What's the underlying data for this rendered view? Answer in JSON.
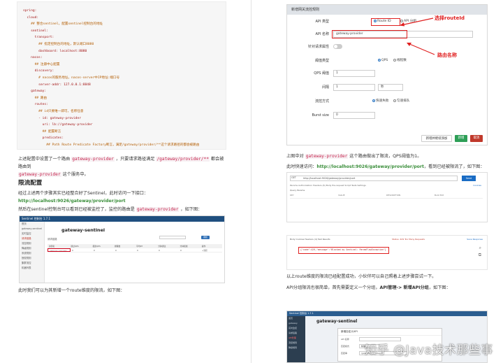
{
  "left_page": {
    "code_lines": [
      {
        "key": "spring:",
        "comment": ""
      },
      {
        "key": "  cloud:",
        "comment": ""
      },
      {
        "key": "",
        "comment": "    ## 整合sentinel，配置sentinel控制台的地址"
      },
      {
        "key": "    sentinel:",
        "comment": ""
      },
      {
        "key": "      transport:",
        "comment": ""
      },
      {
        "key": "",
        "comment": "        ## 指定控制台的地址，默认端口8080"
      },
      {
        "key": "        dashboard: localhost:8080",
        "comment": ""
      },
      {
        "key": "    nacos:",
        "comment": ""
      },
      {
        "key": "",
        "comment": "      ## 注册中心配置"
      },
      {
        "key": "      discovery:",
        "comment": ""
      },
      {
        "key": "",
        "comment": "        # nacos的服务地址，nacos-server中IP地址:端口号"
      },
      {
        "key": "        server-addr: 127.0.0.1:8848",
        "comment": ""
      },
      {
        "key": "    gateway:",
        "comment": ""
      },
      {
        "key": "",
        "comment": "      ## 路由"
      },
      {
        "key": "      routes:",
        "comment": ""
      },
      {
        "key": "",
        "comment": "        ## id只要唯一即可，名称任意"
      },
      {
        "key": "        - id: gateway-provider",
        "comment": ""
      },
      {
        "key": "          uri: lb://gateway-provider",
        "comment": ""
      },
      {
        "key": "",
        "comment": "          ## 配置断言"
      },
      {
        "key": "          predicates:",
        "comment": ""
      },
      {
        "key": "",
        "comment": "            ## Path Route Predicate Factory断言，满足/gateway/provider/**这个请求路径的都会被路由"
      },
      {
        "key": "",
        "comment": "到http://localhost:9024这个uri中"
      },
      {
        "key": "            - Path=/gateway/provider/**",
        "comment": ""
      }
    ],
    "para1_a": "上述配置中设置了一个路由 ",
    "para1_code1": "gateway-provider",
    "para1_b": " ，只要请求路径满足 ",
    "para1_code2": "/gateway/provider/**",
    "para1_c": " 都会被路由到",
    "para1_code3": "gateway-provider",
    "para1_d": " 这个服务中。",
    "heading": "限流配置",
    "para2_a": "经过上述两个步骤其实已经整合好了Sentinel，此时访问一下接口：",
    "para2_link": "http://localhost:9026/gateway/provider/port",
    "para3_a": "然后在sentinel控制台可以看到已经被监控了，监控的路由是 ",
    "para3_code": "gateway-provider",
    "para3_b": " ，如下图：",
    "para4": "此时我们可以为其新增一个route维度的限流，如下图：",
    "sentinel_shot": {
      "topbar": "Sentinel 控制台 1.7.1",
      "title": "gateway-sentinel",
      "subhead": "请求链路",
      "sidebar": [
        "首页",
        "gateway-sentinel",
        "实时监控",
        "请求链路",
        "流控规则",
        "降级规则",
        "系统规则",
        "授权规则",
        "集群流控",
        "机器列表"
      ],
      "btn": "刷新",
      "columns": [
        "资源名",
        "通过QPS",
        "拒绝QPS",
        "线程数",
        "平均RT",
        "分钟通过",
        "分钟拒绝",
        "操作"
      ],
      "row": [
        "gateway-provider",
        "0",
        "0",
        "0",
        "0",
        "0",
        "0",
        "+流控"
      ]
    }
  },
  "right_page": {
    "dialog": {
      "header": "新增网关流控规则",
      "api_type_label": "API 类型",
      "api_type_opt1": "Route ID",
      "api_type_opt2": "API 分组",
      "api_name_label": "API 名称",
      "api_name_value": "gateway-provider",
      "attr_label": "针对请求属性",
      "threshold_type_label": "阈值类型",
      "threshold_opt1": "QPS",
      "threshold_opt2": "线程数",
      "qps_label": "QPS 阈值",
      "qps_value": "1",
      "interval_label": "间隔",
      "interval_value": "1",
      "interval_unit": "秒",
      "control_label": "流控方式",
      "control_opt1": "快速失败",
      "control_opt2": "匀速排队",
      "burst_label": "Burst size",
      "burst_value": "0",
      "footer_link": "新增并继续添加",
      "add_btn": "新增",
      "cancel_btn": "取消"
    },
    "anno_route": "选择routeId",
    "anno_name": "路由名称",
    "para1_a": "上图中对 ",
    "para1_code": "gateway-provider",
    "para1_b": " 这个路由做出了限流，QPS阈值为1。",
    "para2_a": "此时快速访问：",
    "para2_link": "http://localhost:9026/gateway/provider/port",
    "para2_b": "，看到已经被限流了，如下图：",
    "browser": {
      "method": "GET",
      "url": "http://localhost:9026/gateway/provider/port",
      "send": "Send",
      "tabs": "Params  Authorization  Headers (6)  Body  Pre-request Script  Tests  Settings",
      "cookies": "Cookies",
      "query": "Query Params",
      "cols": [
        "KEY",
        "VALUE",
        "DESCRIPTION",
        "Bulk Edit"
      ]
    },
    "response": {
      "tabs": "Body  Cookies  Headers (4)  Test Results",
      "status": "Status: 429 Too Many Requests",
      "save": "Save Response",
      "body": "{\"code\":429,\"message\":\"Blocked by Sentinel: ParamFlowException\"}"
    },
    "para3": "以上route维度的限流已经配置成功，小伙伴可以自己照着上述步骤尝试一下。",
    "para4_a": "API分组限流也很简单，首先需要定义一个分组，",
    "para4_b": "API管理-> 新增API分组",
    "para4_c": "，如下图：",
    "bottom_shot": {
      "topbar": "Sentinel 控制台 1.7.1",
      "title": "gateway-sentinel",
      "modal_title": "新增自定义API",
      "label1": "API 名称",
      "label2": "匹配模式",
      "label3": "匹配串",
      "value1": "",
      "value2": "精确",
      "value3": "/gateway/provider/**",
      "sidebar": [
        "首页",
        "gateway",
        "实时监控",
        "请求链路",
        "API管理",
        "流控规则",
        "降级规则"
      ]
    }
  },
  "watermark": "知乎 @Java技术那些事"
}
